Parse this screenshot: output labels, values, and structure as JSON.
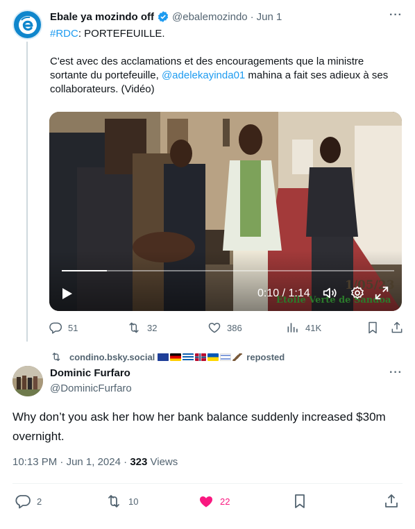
{
  "parent": {
    "author_name": "Ebale ya mozindo off",
    "handle": "@ebalemozindo",
    "separator": "·",
    "date": "Jun 1",
    "more": "···",
    "hashtag": "#RDC",
    "headline_rest": ": PORTEFEUILLE.",
    "body_before": "C'est avec des acclamations et des encouragements que la ministre sortante du portefeuille, ",
    "mention": "@adelekayinda01",
    "body_after": " mahina a fait ses adieux à ses collaborateurs. (Vidéo)",
    "video": {
      "time": "0:10 / 1:14",
      "progress": 0.135,
      "watermark": "Etoile Verte de Sandoa",
      "watermark_date": "1/05/23"
    },
    "stats": {
      "replies": "51",
      "reposts": "32",
      "likes": "386",
      "views": "41K"
    },
    "colors": {
      "verified": "#1d9bf0",
      "logo": "#0f86cc",
      "link": "#1d9bf0"
    }
  },
  "repost": {
    "user": "condino.bsky.social",
    "suffix": "reposted",
    "flags": [
      "eu-flag",
      "germany-flag",
      "greece-flag",
      "norway-flag",
      "ukraine-flag",
      "israel-flag",
      "feather-icon"
    ]
  },
  "reply": {
    "author_name": "Dominic Furfaro",
    "handle": "@DominicFurfaro",
    "more": "···",
    "text": "Why don’t you ask her how her bank balance suddenly increased $30m overnight.",
    "time": "10:13 PM",
    "separator": "·",
    "date": "Jun 1, 2024",
    "view_count": "323",
    "views_label": "Views",
    "stats": {
      "replies": "2",
      "reposts": "10",
      "likes": "22"
    },
    "colors": {
      "liked": "#f91880"
    }
  }
}
